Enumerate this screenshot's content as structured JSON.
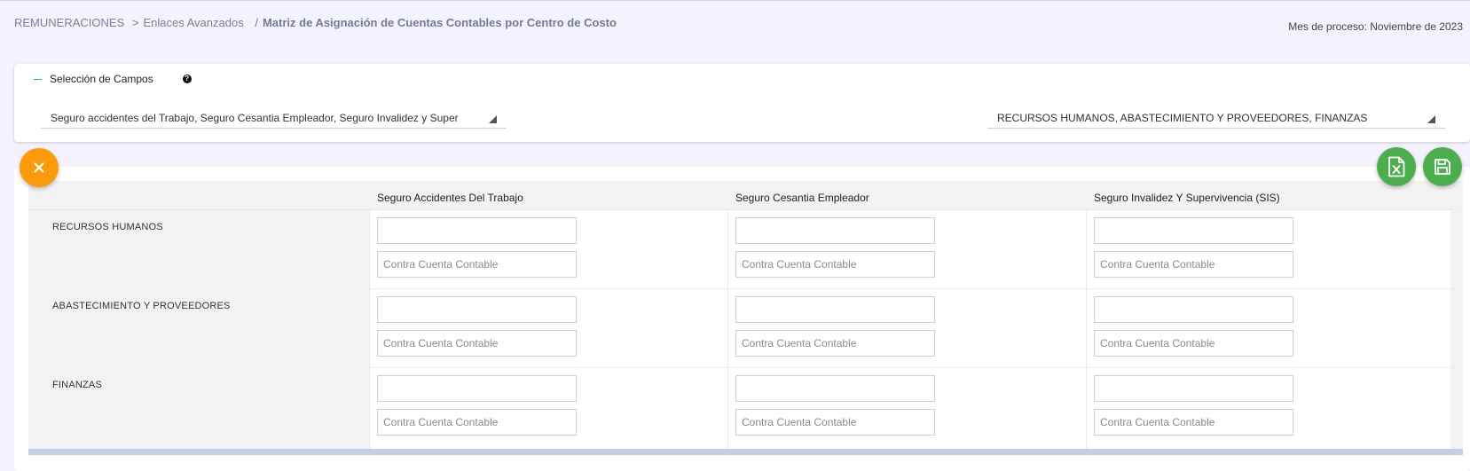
{
  "breadcrumb": {
    "items": [
      "REMUNERACIONES",
      "Enlaces Avanzados"
    ],
    "separator1": ">",
    "separator2": "/",
    "current": "Matriz de Asignación de Cuentas Contables por Centro de Costo"
  },
  "process_month": "Mes de proceso: Noviembre de 2023",
  "selection": {
    "title": "Selección de Campos",
    "help_icon": "?",
    "fields_value": "Seguro accidentes del Trabajo, Seguro Cesantia Empleador, Seguro Invalidez y Super",
    "centers_value": "RECURSOS HUMANOS, ABASTECIMIENTO Y PROVEEDORES, FINANZAS"
  },
  "matrix": {
    "columns": [
      "Seguro Accidentes Del Trabajo",
      "Seguro Cesantia Empleador",
      "Seguro Invalidez Y Supervivencia (SIS)"
    ],
    "rows": [
      "RECURSOS HUMANOS",
      "ABASTECIMIENTO Y PROVEEDORES",
      "FINANZAS"
    ],
    "account_value": "",
    "counter_account_placeholder": "Contra Cuenta Contable"
  },
  "buttons": {
    "close_icon": "close-icon",
    "excel_icon": "excel-icon",
    "save_icon": "save-icon"
  },
  "colors": {
    "close": "#fb9b0c",
    "excel": "#4cae4f",
    "save": "#4cae4f",
    "accent": "#17a2b8"
  }
}
